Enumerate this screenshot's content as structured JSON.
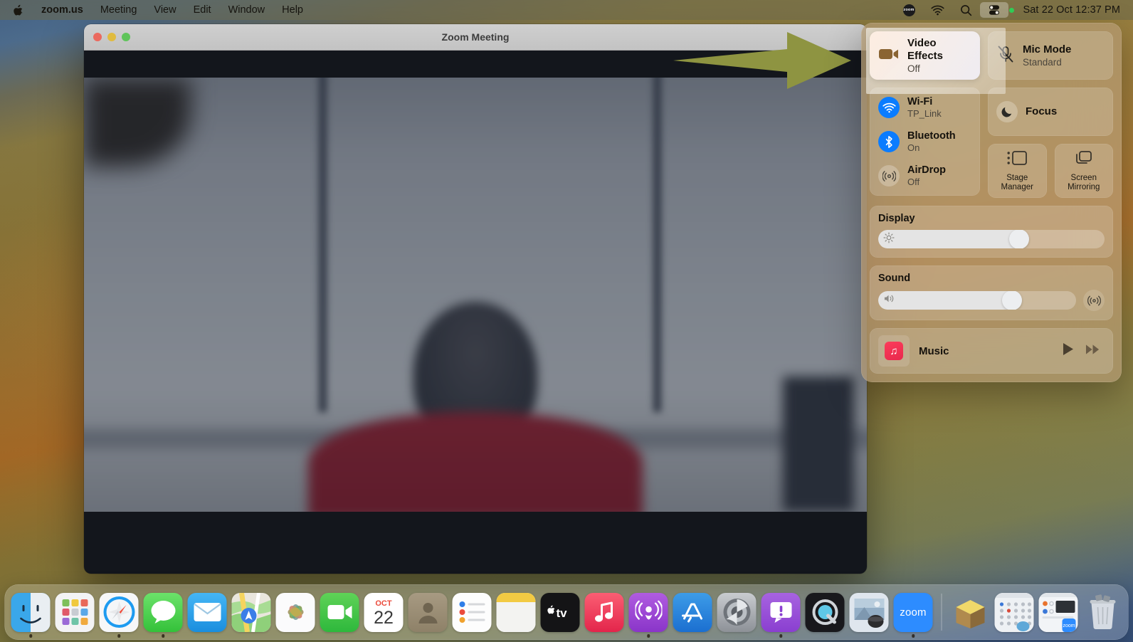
{
  "menubar": {
    "apple_icon": "apple-logo",
    "items": [
      {
        "label": "zoom.us",
        "bold": true
      },
      {
        "label": "Meeting",
        "bold": false
      },
      {
        "label": "View",
        "bold": false
      },
      {
        "label": "Edit",
        "bold": false
      },
      {
        "label": "Window",
        "bold": false
      },
      {
        "label": "Help",
        "bold": false
      }
    ],
    "status_icons": [
      "zoom-menubar-icon",
      "wifi-icon",
      "search-icon",
      "control-center-icon",
      "recording-indicator-dot"
    ],
    "zoom_badge_text": "zoom",
    "clock": "Sat 22 Oct  12:37 PM"
  },
  "window": {
    "title": "Zoom Meeting",
    "traffic_lights": [
      "close",
      "minimize",
      "zoom"
    ]
  },
  "control_center": {
    "video_effects": {
      "title": "Video Effects",
      "subtitle": "Off",
      "icon": "video-camera-icon"
    },
    "mic_mode": {
      "title": "Mic Mode",
      "subtitle": "Standard",
      "icon": "microphone-slash-icon"
    },
    "connectivity": [
      {
        "title": "Wi-Fi",
        "subtitle": "TP_Link",
        "icon": "wifi-icon",
        "state": "on"
      },
      {
        "title": "Bluetooth",
        "subtitle": "On",
        "icon": "bluetooth-icon",
        "state": "on"
      },
      {
        "title": "AirDrop",
        "subtitle": "Off",
        "icon": "airdrop-icon",
        "state": "off"
      }
    ],
    "focus": {
      "title": "Focus",
      "icon": "moon-icon"
    },
    "stage_manager": {
      "label": "Stage\nManager",
      "label_line1": "Stage",
      "label_line2": "Manager",
      "icon": "stage-manager-icon"
    },
    "screen_mirroring": {
      "label_line1": "Screen",
      "label_line2": "Mirroring",
      "icon": "screen-mirroring-icon"
    },
    "display": {
      "label": "Display",
      "icon": "brightness-icon",
      "value_percent": 66
    },
    "sound": {
      "label": "Sound",
      "icon": "speaker-icon",
      "value_percent": 72,
      "output_icon": "airplay-icon"
    },
    "music": {
      "title": "Music",
      "icon": "music-note-icon",
      "play_icon": "play-icon",
      "next_icon": "fast-forward-icon"
    }
  },
  "annotation": {
    "arrow": "green-arrow-pointing-right",
    "color": "#8e9441"
  },
  "dock": {
    "items": [
      {
        "name": "finder",
        "label": "Finder",
        "running": true
      },
      {
        "name": "launchpad",
        "label": "Launchpad",
        "running": false
      },
      {
        "name": "safari",
        "label": "Safari",
        "running": true
      },
      {
        "name": "messages",
        "label": "Messages",
        "running": true
      },
      {
        "name": "mail",
        "label": "Mail",
        "running": false
      },
      {
        "name": "maps",
        "label": "Maps",
        "running": false
      },
      {
        "name": "photos",
        "label": "Photos",
        "running": false
      },
      {
        "name": "facetime",
        "label": "FaceTime",
        "running": false
      },
      {
        "name": "calendar",
        "label": "Calendar",
        "running": false,
        "month": "OCT",
        "day": "22"
      },
      {
        "name": "contacts",
        "label": "Contacts",
        "running": false
      },
      {
        "name": "reminders",
        "label": "Reminders",
        "running": false
      },
      {
        "name": "notes",
        "label": "Notes",
        "running": false
      },
      {
        "name": "appletv",
        "label": "TV",
        "running": false
      },
      {
        "name": "music",
        "label": "Music",
        "running": false
      },
      {
        "name": "podcasts",
        "label": "Podcasts",
        "running": true
      },
      {
        "name": "appstore",
        "label": "App Store",
        "running": false
      },
      {
        "name": "system-settings",
        "label": "System Settings",
        "running": false
      },
      {
        "name": "feedback-assistant",
        "label": "Feedback Assistant",
        "running": true
      },
      {
        "name": "quicktime",
        "label": "QuickTime Player",
        "running": false
      },
      {
        "name": "preview",
        "label": "Preview",
        "running": false
      },
      {
        "name": "zoom",
        "label": "zoom",
        "running": true
      }
    ],
    "minimized": [
      {
        "name": "downloads-stack",
        "label": "Downloads"
      },
      {
        "name": "minimized-window-grid",
        "label": "Minimized Window"
      },
      {
        "name": "minimized-window-settings",
        "label": "Minimized Window"
      }
    ],
    "trash": {
      "name": "trash",
      "label": "Trash"
    },
    "zoom_tile_text": "zoom"
  }
}
